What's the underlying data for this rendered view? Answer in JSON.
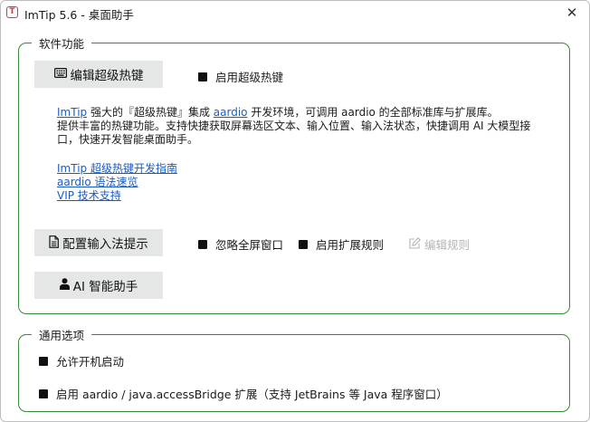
{
  "window": {
    "title": "ImTip 5.6 - 桌面助手",
    "app_icon_glyph": "T",
    "close_glyph": "✕"
  },
  "software": {
    "legend": "软件功能",
    "edit_hotkey_button": "编辑超级热键",
    "edit_hotkey_icon": "keyboard-icon",
    "enable_hotkey": "启用超级热键",
    "desc": {
      "link1": "ImTip",
      "text1": " 强大的『超级热键』集成 ",
      "link2": "aardio",
      "text2": " 开发环境，可调用 aardio 的全部标准库与扩展库。",
      "line2": "提供丰富的热键功能。支持快捷获取屏幕选区文本、输入位置、输入法状态，快捷调用 AI 大模型接口，快速开发智能桌面助手。"
    },
    "links": [
      "ImTip 超级热键开发指南",
      "aardio 语法速览",
      "VIP 技术支持"
    ],
    "config_ime_button": "配置输入法提示",
    "config_ime_icon": "document-icon",
    "ignore_fullscreen": "忽略全屏窗口",
    "enable_ext_rules": "启用扩展规则",
    "edit_rules": "编辑规则",
    "edit_rules_icon": "edit-icon",
    "ai_button": "AI 智能助手",
    "ai_icon": "user-icon"
  },
  "general": {
    "legend": "通用选项",
    "autostart": "允许开机启动",
    "access_bridge": "启用 aardio / java.accessBridge 扩展（支持 JetBrains 等 Java 程序窗口）"
  }
}
